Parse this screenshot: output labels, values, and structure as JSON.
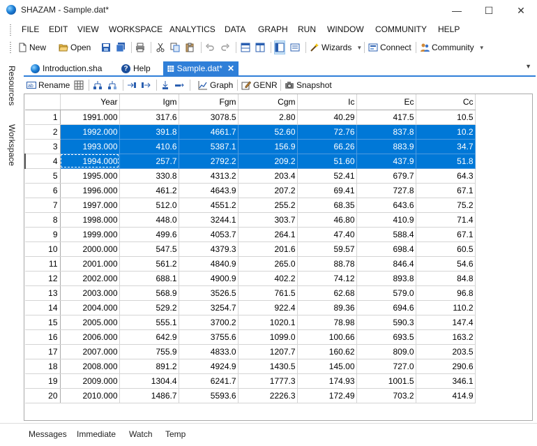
{
  "window": {
    "title": "SHAZAM - Sample.dat*",
    "minimize": "—",
    "maximize": "☐",
    "close": "✕"
  },
  "menu": [
    "FILE",
    "EDIT",
    "VIEW",
    "WORKSPACE",
    "ANALYTICS",
    "DATA",
    "GRAPH",
    "RUN",
    "WINDOW",
    "COMMUNITY",
    "HELP"
  ],
  "toolbar": {
    "new": "New",
    "open": "Open",
    "wizards": "Wizards",
    "connect": "Connect",
    "community": "Community"
  },
  "sidebar": {
    "resources": "Resources",
    "workspace": "Workspace"
  },
  "tabs": [
    {
      "label": "Introduction.sha"
    },
    {
      "label": "Help"
    },
    {
      "label": "Sample.dat*",
      "close": "✕"
    }
  ],
  "gridtools": {
    "rename": "Rename",
    "graph": "Graph",
    "genr": "GENR",
    "snapshot": "Snapshot"
  },
  "grid": {
    "columns": [
      "Year",
      "Igm",
      "Fgm",
      "Cgm",
      "Ic",
      "Ec",
      "Cc"
    ],
    "rows": [
      [
        "1",
        "1991.000",
        "317.6",
        "3078.5",
        "2.80",
        "40.29",
        "417.5",
        "10.5"
      ],
      [
        "2",
        "1992.000",
        "391.8",
        "4661.7",
        "52.60",
        "72.76",
        "837.8",
        "10.2"
      ],
      [
        "3",
        "1993.000",
        "410.6",
        "5387.1",
        "156.9",
        "66.26",
        "883.9",
        "34.7"
      ],
      [
        "4",
        "1994.000",
        "257.7",
        "2792.2",
        "209.2",
        "51.60",
        "437.9",
        "51.8"
      ],
      [
        "5",
        "1995.000",
        "330.8",
        "4313.2",
        "203.4",
        "52.41",
        "679.7",
        "64.3"
      ],
      [
        "6",
        "1996.000",
        "461.2",
        "4643.9",
        "207.2",
        "69.41",
        "727.8",
        "67.1"
      ],
      [
        "7",
        "1997.000",
        "512.0",
        "4551.2",
        "255.2",
        "68.35",
        "643.6",
        "75.2"
      ],
      [
        "8",
        "1998.000",
        "448.0",
        "3244.1",
        "303.7",
        "46.80",
        "410.9",
        "71.4"
      ],
      [
        "9",
        "1999.000",
        "499.6",
        "4053.7",
        "264.1",
        "47.40",
        "588.4",
        "67.1"
      ],
      [
        "10",
        "2000.000",
        "547.5",
        "4379.3",
        "201.6",
        "59.57",
        "698.4",
        "60.5"
      ],
      [
        "11",
        "2001.000",
        "561.2",
        "4840.9",
        "265.0",
        "88.78",
        "846.4",
        "54.6"
      ],
      [
        "12",
        "2002.000",
        "688.1",
        "4900.9",
        "402.2",
        "74.12",
        "893.8",
        "84.8"
      ],
      [
        "13",
        "2003.000",
        "568.9",
        "3526.5",
        "761.5",
        "62.68",
        "579.0",
        "96.8"
      ],
      [
        "14",
        "2004.000",
        "529.2",
        "3254.7",
        "922.4",
        "89.36",
        "694.6",
        "110.2"
      ],
      [
        "15",
        "2005.000",
        "555.1",
        "3700.2",
        "1020.1",
        "78.98",
        "590.3",
        "147.4"
      ],
      [
        "16",
        "2006.000",
        "642.9",
        "3755.6",
        "1099.0",
        "100.66",
        "693.5",
        "163.2"
      ],
      [
        "17",
        "2007.000",
        "755.9",
        "4833.0",
        "1207.7",
        "160.62",
        "809.0",
        "203.5"
      ],
      [
        "18",
        "2008.000",
        "891.2",
        "4924.9",
        "1430.5",
        "145.00",
        "727.0",
        "290.6"
      ],
      [
        "19",
        "2009.000",
        "1304.4",
        "6241.7",
        "1777.3",
        "174.93",
        "1001.5",
        "346.1"
      ],
      [
        "20",
        "2010.000",
        "1486.7",
        "5593.6",
        "2226.3",
        "172.49",
        "703.2",
        "414.9"
      ]
    ],
    "selected_rows": [
      2,
      3,
      4
    ],
    "current_row": 4
  },
  "bottom_tabs": [
    "Messages",
    "Immediate",
    "Watch",
    "Temp"
  ],
  "colors": {
    "selection": "#0078d7",
    "active_tab": "#2f7fd8"
  }
}
